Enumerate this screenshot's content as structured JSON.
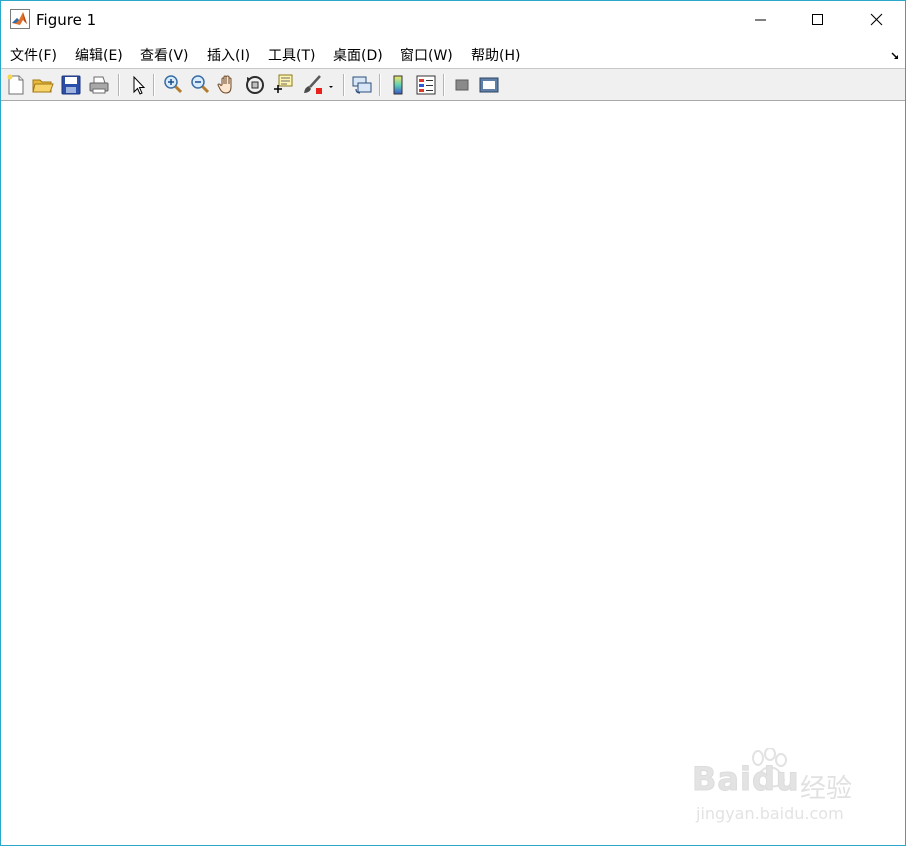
{
  "window": {
    "title": "Figure 1",
    "border_color": "#2aa7c9"
  },
  "titlebar": {
    "app_icon": "matlab-icon",
    "minimize_icon": "minimize-icon",
    "maximize_icon": "maximize-icon",
    "close_icon": "close-icon"
  },
  "menu": {
    "items": [
      {
        "label": "文件(F)"
      },
      {
        "label": "编辑(E)"
      },
      {
        "label": "查看(V)"
      },
      {
        "label": "插入(I)"
      },
      {
        "label": "工具(T)"
      },
      {
        "label": "桌面(D)"
      },
      {
        "label": "窗口(W)"
      },
      {
        "label": "帮助(H)"
      }
    ],
    "expand_icon": "dock-arrow-icon"
  },
  "toolbar": {
    "buttons": [
      "new-figure-icon",
      "open-file-icon",
      "save-icon",
      "print-icon",
      "edit-plot-pointer-icon",
      "zoom-in-icon",
      "zoom-out-icon",
      "pan-hand-icon",
      "rotate-3d-icon",
      "data-cursor-icon",
      "brush-icon",
      "brush-dropdown-icon",
      "link-plot-icon",
      "insert-colorbar-icon",
      "insert-legend-icon",
      "hide-plot-tools-icon",
      "show-plot-tools-icon"
    ]
  },
  "watermark": {
    "brand": "Baidu",
    "cn": "经验",
    "url": "jingyan.baidu.com"
  }
}
